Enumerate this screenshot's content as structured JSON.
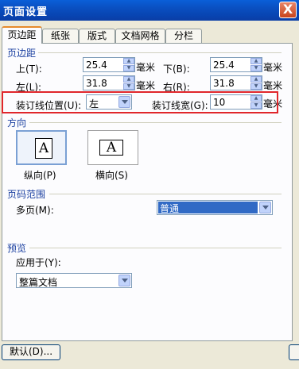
{
  "window": {
    "title": "页面设置",
    "close_label": "X"
  },
  "tabs": [
    {
      "label": "页边距",
      "active": true
    },
    {
      "label": "纸张",
      "active": false
    },
    {
      "label": "版式",
      "active": false
    },
    {
      "label": "文档网格",
      "active": false
    },
    {
      "label": "分栏",
      "active": false
    }
  ],
  "margins": {
    "section_title": "页边距",
    "top": {
      "label": "上(T):",
      "value": "25.4",
      "unit": "毫米"
    },
    "bottom": {
      "label": "下(B):",
      "value": "25.4",
      "unit": "毫米"
    },
    "left": {
      "label": "左(L):",
      "value": "31.8",
      "unit": "毫米"
    },
    "right": {
      "label": "右(R):",
      "value": "31.8",
      "unit": "毫米"
    },
    "gutter_position": {
      "label": "装订线位置(U):",
      "value": "左"
    },
    "gutter": {
      "label": "装订线宽(G):",
      "value": "10",
      "unit": "毫米"
    }
  },
  "orientation": {
    "section_title": "方向",
    "portrait": {
      "glyph": "A",
      "label": "纵向(P)",
      "selected": true
    },
    "landscape": {
      "glyph": "A",
      "label": "横向(S)",
      "selected": false
    }
  },
  "pages": {
    "section_title": "页码范围",
    "multiple_label": "多页(M):",
    "multiple_value": "普通"
  },
  "preview": {
    "section_title": "预览",
    "apply_to_label": "应用于(Y):",
    "apply_to_value": "整篇文档"
  },
  "footer": {
    "default_button": "默认(D)..."
  },
  "colors": {
    "accent_blue": "#1a3fa0",
    "highlight_red": "#e0262b",
    "titlebar": "#0a4fc0"
  }
}
